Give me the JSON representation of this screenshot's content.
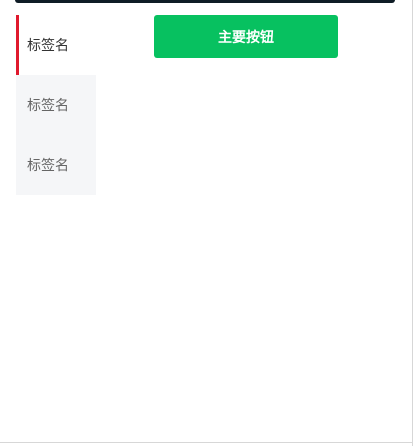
{
  "sidebar": {
    "items": [
      {
        "label": "标签名",
        "active": true
      },
      {
        "label": "标签名",
        "active": false
      },
      {
        "label": "标签名",
        "active": false
      }
    ]
  },
  "main": {
    "primary_button_label": "主要按钮"
  },
  "colors": {
    "accent_active": "#e0192d",
    "primary_button": "#07c160",
    "sidebar_bg": "#f5f6f8"
  }
}
